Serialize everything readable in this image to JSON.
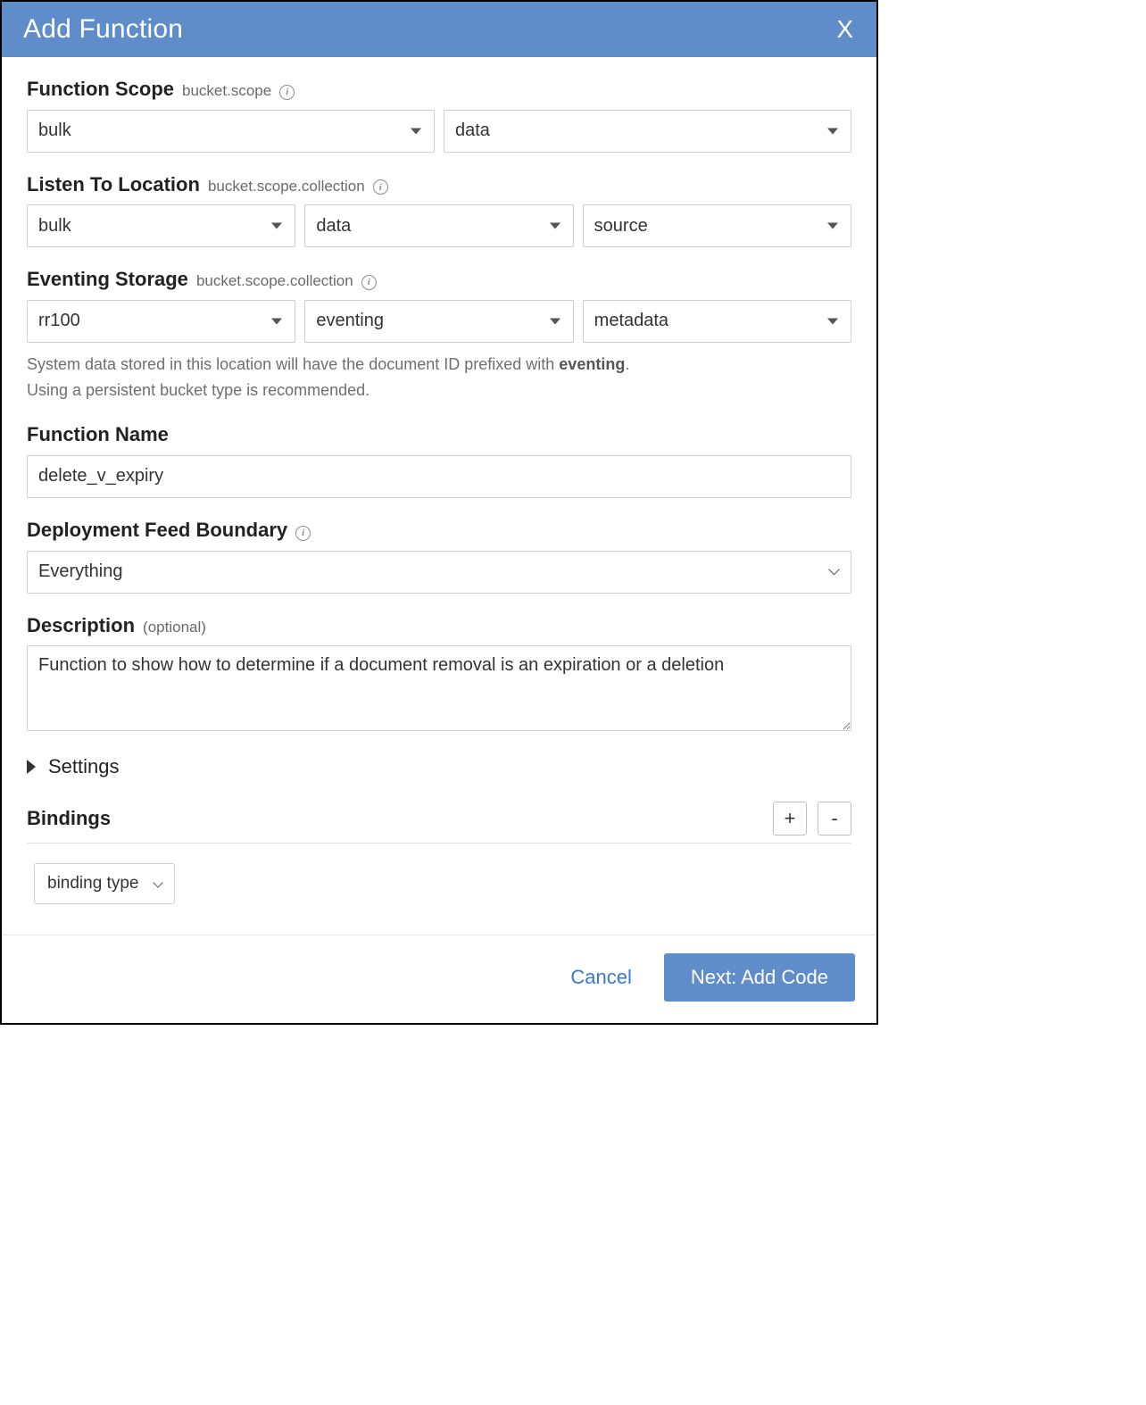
{
  "dialog": {
    "title": "Add Function",
    "close_glyph": "X"
  },
  "function_scope": {
    "label": "Function Scope",
    "hint": "bucket.scope",
    "bucket": "bulk",
    "scope": "data"
  },
  "listen_to": {
    "label": "Listen To Location",
    "hint": "bucket.scope.collection",
    "bucket": "bulk",
    "scope": "data",
    "collection": "source"
  },
  "eventing_storage": {
    "label": "Eventing Storage",
    "hint": "bucket.scope.collection",
    "bucket": "rr100",
    "scope": "eventing",
    "collection": "metadata",
    "helper_prefix": "System data stored in this location will have the document ID prefixed with ",
    "helper_bold": "eventing",
    "helper_suffix": ".",
    "helper_line2": "Using a persistent bucket type is recommended."
  },
  "function_name": {
    "label": "Function Name",
    "value": "delete_v_expiry"
  },
  "feed_boundary": {
    "label": "Deployment Feed Boundary",
    "value": "Everything"
  },
  "description": {
    "label": "Description",
    "suffix": "(optional)",
    "value": "Function to show how to determine if a document removal is an expiration or a deletion"
  },
  "settings": {
    "label": "Settings"
  },
  "bindings": {
    "label": "Bindings",
    "add": "+",
    "remove": "-",
    "type_select": "binding type"
  },
  "footer": {
    "cancel": "Cancel",
    "next": "Next: Add Code"
  }
}
